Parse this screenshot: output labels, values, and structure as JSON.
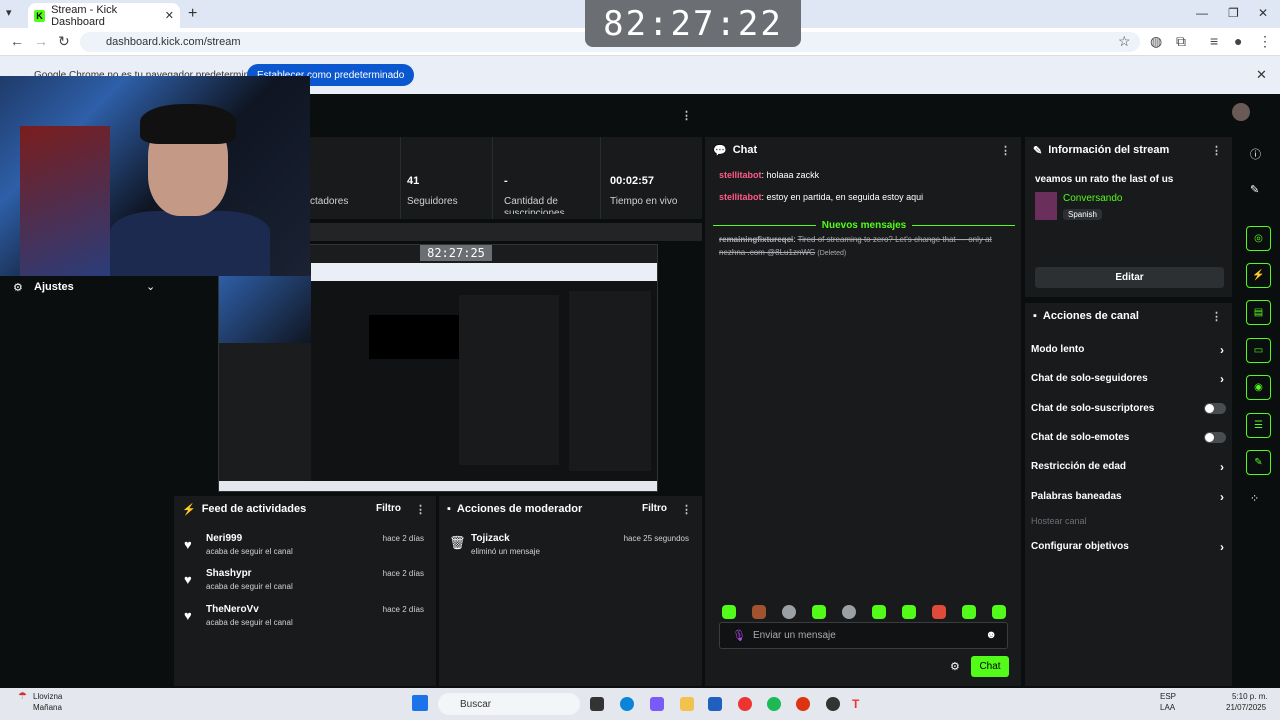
{
  "browser": {
    "tab_title": "Stream - Kick Dashboard",
    "tab_favicon": "K",
    "address": "dashboard.kick.com/stream",
    "infobar_text": "Google Chrome no es tu navegador predeterminado",
    "infobar_button": "Establecer como predeterminado"
  },
  "timer": "82:27:22",
  "stats": {
    "viewers_label": "ctadores",
    "followers_value": "41",
    "followers_label": "Seguidores",
    "subs_value": "-",
    "subs_label": "Cantidad de suscripciones",
    "live_value": "00:02:57",
    "live_label": "Tiempo en vivo"
  },
  "preview_timer": "82:27:25",
  "ajustes": {
    "label": "Ajustes"
  },
  "activity": {
    "title": "Feed de actividades",
    "filter": "Filtro",
    "items": [
      {
        "name": "Neri999",
        "action": "acaba de seguir el canal",
        "time": "hace 2 días"
      },
      {
        "name": "Shashypr",
        "action": "acaba de seguir el canal",
        "time": "hace 2 días"
      },
      {
        "name": "TheNeroVv",
        "action": "acaba de seguir el canal",
        "time": "hace 2 días"
      }
    ]
  },
  "mod": {
    "title": "Acciones de moderador",
    "filter": "Filtro",
    "items": [
      {
        "name": "Tojizack",
        "action": "eliminó un mensaje",
        "time": "hace 25 segundos"
      }
    ]
  },
  "chat": {
    "title": "Chat",
    "messages": [
      {
        "user": "stellitabot",
        "text": "holaaa zackk"
      },
      {
        "user": "stellitabot",
        "text": "estoy en partida, en seguida estoy aqui"
      }
    ],
    "new_messages_label": "Nuevos mensajes",
    "deleted_message": {
      "user": "remainingfixtureqci",
      "text": "Tired of streaming to zero? Let's change that — only at nezhna .com @8Lu1znWG",
      "tag": "(Deleted)"
    },
    "input_placeholder": "Enviar un mensaje",
    "send_label": "Chat"
  },
  "stream_info": {
    "title": "Información del stream",
    "stream_title": "veamos un rato the last of us",
    "category": "Conversando",
    "language": "Spanish",
    "edit_label": "Editar"
  },
  "channel_actions": {
    "title": "Acciones de canal",
    "items": [
      {
        "label": "Modo lento",
        "kind": "chevron"
      },
      {
        "label": "Chat de solo-seguidores",
        "kind": "chevron"
      },
      {
        "label": "Chat de solo-suscriptores",
        "kind": "toggle"
      },
      {
        "label": "Chat de solo-emotes",
        "kind": "toggle"
      },
      {
        "label": "Restricción de edad",
        "kind": "chevron"
      },
      {
        "label": "Palabras baneadas",
        "kind": "chevron"
      },
      {
        "label": "Hostear canal",
        "kind": "disabled"
      },
      {
        "label": "Configurar objetivos",
        "kind": "chevron"
      }
    ]
  },
  "taskbar": {
    "weather_temp": "Llovizna",
    "weather_sub": "Mañana",
    "search_label": "Buscar",
    "lang": "ESP",
    "lang_sub": "LAA",
    "time": "5:10 p. m.",
    "date": "21/07/2025"
  },
  "colors": {
    "accent": "#53fc18",
    "username": "#ff5a87",
    "panel": "#181a1c",
    "background": "#0b0e0f"
  }
}
